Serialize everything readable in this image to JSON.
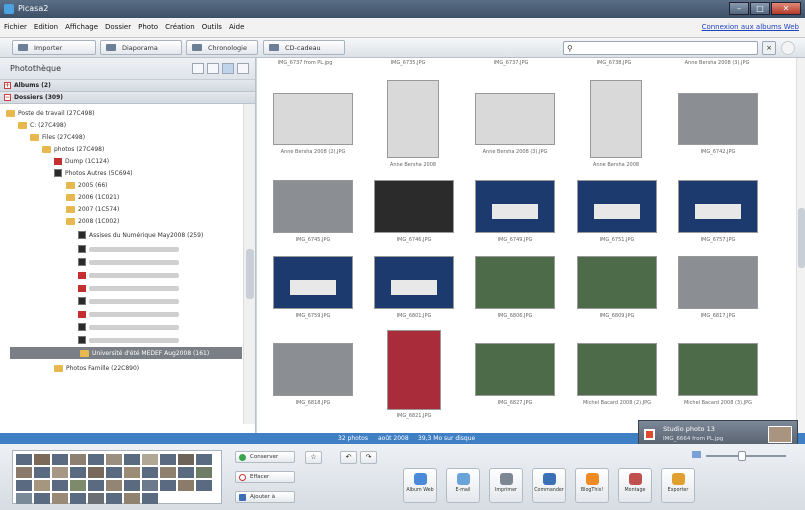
{
  "window": {
    "title": "Picasa2"
  },
  "menu": [
    "Fichier",
    "Edition",
    "Affichage",
    "Dossier",
    "Photo",
    "Création",
    "Outils",
    "Aide"
  ],
  "menu_link": "Connexion aux albums Web",
  "toolbar": {
    "import": "Importer",
    "slideshow": "Diaporama",
    "timeline": "Chronologie",
    "cd": "CD-cadeau"
  },
  "library": {
    "title": "Photothèque",
    "albums": "Albums (2)",
    "folders": "Dossiers (309)",
    "tree": [
      "Poste de travail (27C498)",
      "C: (27C498)",
      "Files (27C498)",
      "photos (27C498)",
      "Dump (1C124)",
      "Photos Autres (5C694)",
      "2005 (66)",
      "2006 (1C021)",
      "2007 (1C574)",
      "2008 (1C002)",
      "Assises du Numérique May2008 (259)",
      "Université d'été MEDEF Aug2008 (161)",
      "Photos Famille (22C890)"
    ]
  },
  "grid": {
    "top_captions": [
      "IMG_6737 from PL.jpg",
      "IMG_6735.JPG",
      "IMG_6737.JPG",
      "IMG_6738.JPG",
      "Anne Bersha 2008 (3).JPG"
    ],
    "row1_captions": [
      "Anne Bersha 2008 (2).JPG",
      "Anne Bersha 2008",
      "Anne Bersha 2008 (3).JPG",
      "Anne Bersha 2008",
      "IMG_6742.JPG"
    ],
    "row2_captions": [
      "IMG_6745.JPG",
      "IMG_6746.JPG",
      "IMG_6749.JPG",
      "IMG_6751.JPG",
      "IMG_6757.JPG"
    ],
    "row3_captions": [
      "IMG_6759.JPG",
      "IMG_6801.JPG",
      "IMG_6806.JPG",
      "IMG_6809.JPG",
      "IMG_6817.JPG"
    ],
    "row4_captions": [
      "IMG_6818.JPG",
      "IMG_6821.JPG",
      "IMG_6827.JPG",
      "Michel Bacard 2008 (2).JPG",
      "Michel Bacard 2008 (3).JPG"
    ]
  },
  "status": {
    "count": "32 photos",
    "date": "août 2008",
    "size": "39,3 Mo sur disque"
  },
  "notification": {
    "title": "Studio photo 13",
    "file": "IMG_6664 from PL.jpg"
  },
  "bottom": {
    "keep": "Conserver",
    "clear": "Effacer",
    "add": "Ajouter à",
    "actions": [
      "Album Web",
      "E-mail",
      "Imprimer",
      "Commander",
      "BlogThis!",
      "Montage",
      "Exporter"
    ]
  },
  "colors": {
    "status": "#3f7fc4",
    "selected": "#7a7f86"
  }
}
